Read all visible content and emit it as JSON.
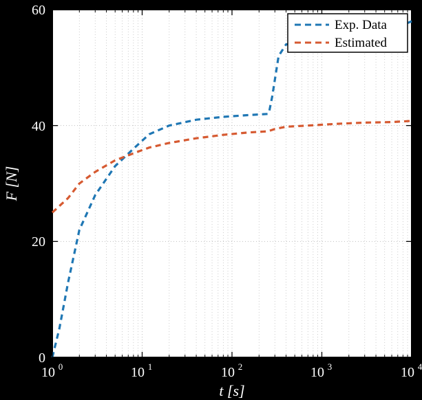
{
  "chart_data": {
    "type": "line",
    "xlabel": "t [s]",
    "ylabel": "F [N]",
    "xscale": "log",
    "title": "",
    "xlim": [
      1,
      10000
    ],
    "ylim": [
      0,
      60
    ],
    "xticks_major": [
      1,
      10,
      100,
      1000,
      10000
    ],
    "xtick_labels": [
      "10^0",
      "10^1",
      "10^2",
      "10^3",
      "10^4"
    ],
    "yticks": [
      0,
      20,
      40,
      60
    ],
    "legend_position": "upper-right",
    "series": [
      {
        "name": "Exp. Data",
        "color": "#1f77b4",
        "dash": "8,6",
        "x": [
          1,
          1.2,
          1.5,
          2,
          3,
          5,
          8,
          12,
          20,
          40,
          80,
          150,
          250,
          260,
          280,
          330,
          400,
          700,
          1500,
          3000,
          6000,
          10000
        ],
        "y": [
          0,
          5,
          13,
          22,
          28,
          33,
          36,
          38.5,
          40,
          41,
          41.5,
          41.8,
          42,
          42.5,
          45,
          52,
          54,
          54.5,
          55,
          55.5,
          56.5,
          58
        ]
      },
      {
        "name": "Estimated",
        "color": "#d65a31",
        "dash": "8,6",
        "x": [
          1,
          1.5,
          2,
          3,
          5,
          8,
          12,
          20,
          40,
          80,
          150,
          250,
          300,
          400,
          700,
          1500,
          3000,
          6000,
          10000
        ],
        "y": [
          25,
          27.5,
          30,
          32,
          34,
          35.2,
          36.2,
          37,
          37.8,
          38.4,
          38.8,
          39,
          39.4,
          39.8,
          40,
          40.3,
          40.5,
          40.6,
          40.8
        ]
      }
    ]
  },
  "legend": {
    "items": [
      {
        "label": "Exp. Data"
      },
      {
        "label": "Estimated"
      }
    ]
  },
  "axis_labels": {
    "x": "t [s]",
    "y": "F [N]"
  },
  "tick_labels": {
    "y": {
      "0": "0",
      "20": "20",
      "40": "40",
      "60": "60"
    },
    "x_exp": {
      "0": "0",
      "1": "1",
      "2": "2",
      "3": "3",
      "4": "4"
    }
  }
}
